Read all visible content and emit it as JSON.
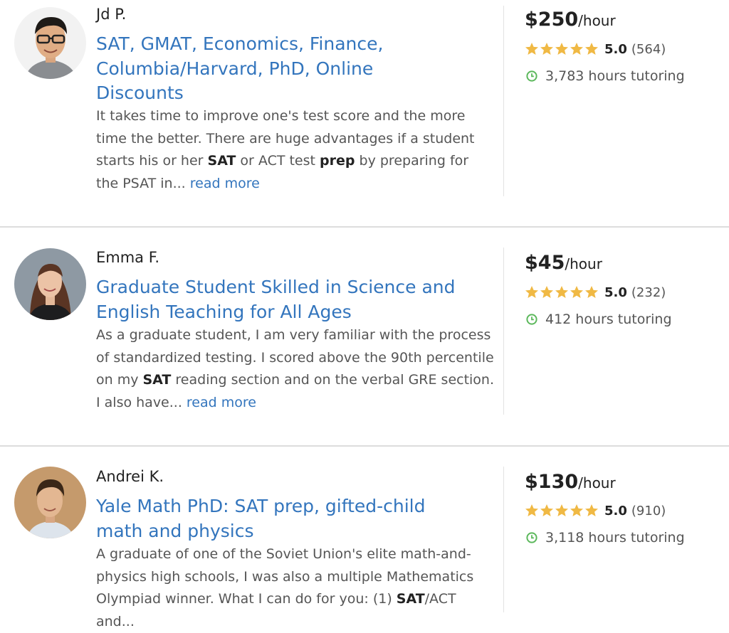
{
  "tutors": [
    {
      "name": "Jd P.",
      "title_lines": [
        "SAT, GMAT, Economics, Finance,",
        "Columbia/Harvard, PhD, Online",
        "Discounts"
      ],
      "description_segments": [
        {
          "text": "It takes time to improve one's test score and the more time the better. There are huge advantages if a student starts his or her ",
          "bold": false
        },
        {
          "text": "SAT",
          "bold": true
        },
        {
          "text": " or ACT test ",
          "bold": false
        },
        {
          "text": "prep",
          "bold": true
        },
        {
          "text": " by preparing for the PSAT in... ",
          "bold": false
        }
      ],
      "read_more": "read more",
      "price": "$250",
      "price_unit": "/hour",
      "rating": "5.0",
      "review_count": "(564)",
      "hours": "3,783 hours tutoring",
      "stars": 5
    },
    {
      "name": "Emma F.",
      "title_lines": [
        "Graduate Student Skilled in Science and",
        "English Teaching for All Ages"
      ],
      "description_segments": [
        {
          "text": "As a graduate student, I am very familiar with the process of standardized testing. I scored above the 90th percentile on my ",
          "bold": false
        },
        {
          "text": "SAT",
          "bold": true
        },
        {
          "text": " reading section and on the verbal GRE section. I also have... ",
          "bold": false
        }
      ],
      "read_more": "read more",
      "price": "$45",
      "price_unit": "/hour",
      "rating": "5.0",
      "review_count": "(232)",
      "hours": "412 hours tutoring",
      "stars": 5
    },
    {
      "name": "Andrei K.",
      "title_lines": [
        "Yale Math PhD: SAT prep, gifted-child",
        "math and physics"
      ],
      "description_segments": [
        {
          "text": "A graduate of one of the Soviet Union's elite math-and-physics high schools, I was also a multiple Mathematics Olympiad winner. What I can do for you: (1) ",
          "bold": false
        },
        {
          "text": "SAT",
          "bold": true
        },
        {
          "text": "/ACT and...",
          "bold": false
        }
      ],
      "price": "$130",
      "price_unit": "/hour",
      "rating": "5.0",
      "review_count": "(910)",
      "hours": "3,118 hours tutoring",
      "stars": 5
    }
  ],
  "icons": {
    "star": "star-icon",
    "clock": "clock-icon"
  },
  "colors": {
    "link": "#3375bd",
    "star": "#f0b944",
    "clock": "#5cb85c",
    "divider": "#dddddd"
  }
}
